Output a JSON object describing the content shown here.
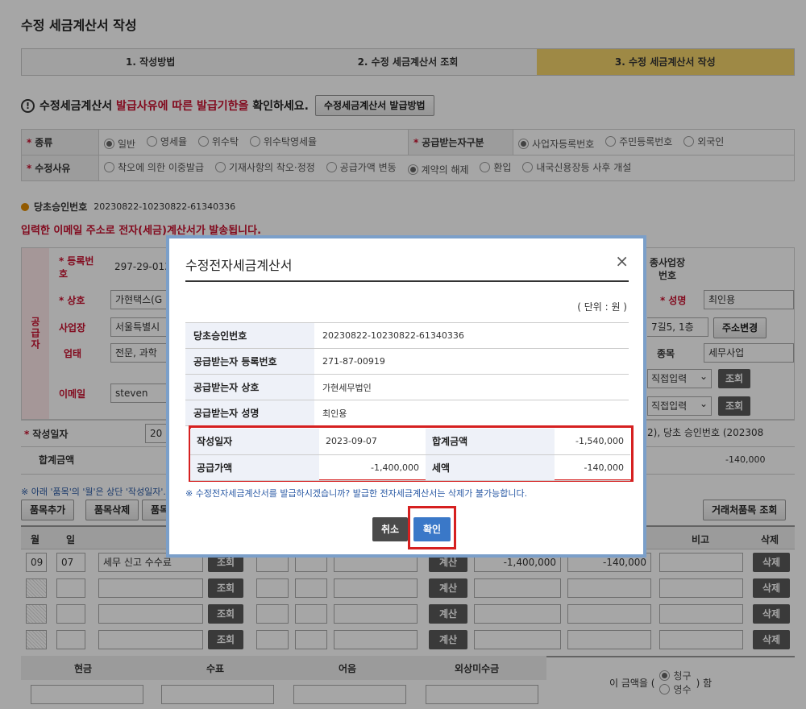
{
  "page": {
    "title": "수정 세금계산서 작성"
  },
  "steps": [
    {
      "label": "1. 작성방법"
    },
    {
      "label": "2. 수정 세금계산서 조회"
    },
    {
      "label": "3. 수정 세금계산서 작성"
    }
  ],
  "notice": {
    "prefix": "수정세금계산서",
    "emphasis": "발급사유에 따른 발급기한을",
    "suffix": "확인하세요.",
    "button": "수정세금계산서 발급방법"
  },
  "kind": {
    "label": "종류",
    "options": [
      "일반",
      "영세율",
      "위수탁",
      "위수탁영세율"
    ],
    "receiver_label": "공급받는자구분",
    "receiver_options": [
      "사업자등록번호",
      "주민등록번호",
      "외국인"
    ]
  },
  "reason": {
    "label": "수정사유",
    "options": [
      "착오에 의한 이중발급",
      "기재사항의 착오·정정",
      "공급가액 변동",
      "계약의 해제",
      "환입",
      "내국신용장등 사후 개설"
    ]
  },
  "original": {
    "label": "당초승인번호",
    "value": "20230822-10230822-61340336"
  },
  "email_notice": "입력한 이메일 주소로 전자(세금)계산서가 발송됩니다.",
  "supplier": {
    "side": "공급자",
    "reg_label": "등록번호",
    "reg_value": "297-29-01318",
    "name_label": "상호",
    "name_value": "가현택스(G",
    "addr_label": "사업장",
    "addr_value": "서울특별시",
    "type_label": "업태",
    "type_value": "전문, 과학",
    "email_label": "이메일",
    "email_value": "steven",
    "sub_branch": "종사업장 번호",
    "rep_label": "성명",
    "rep_value": "최인용",
    "addr_tail": "7길5, 1층",
    "addr_btn": "주소변경",
    "item_label": "종목",
    "item_value": "세무사업",
    "direct": "직접입력",
    "lookup": "조회"
  },
  "date_row": {
    "label": "작성일자",
    "value_prefix": "20",
    "tail": "2), 당초 승인번호 (202308"
  },
  "total_row": {
    "label": "합계금액",
    "value": "-140,000"
  },
  "items": {
    "note": "※ 아래 '품목'의 '월'은 상단 '작성일자'...",
    "add": "품목추가",
    "del": "품목삭제",
    "more": "품목",
    "partner": "거래처품목 조회",
    "headers": {
      "month": "월",
      "day": "일",
      "remark": "비고",
      "delete": "삭제"
    },
    "rows": [
      {
        "month": "09",
        "day": "07",
        "name": "세무 신고 수수료",
        "supply": "-1,400,000",
        "tax": "-140,000"
      },
      {
        "month": "",
        "day": "",
        "name": "",
        "supply": "",
        "tax": ""
      },
      {
        "month": "",
        "day": "",
        "name": "",
        "supply": "",
        "tax": ""
      },
      {
        "month": "",
        "day": "",
        "name": "",
        "supply": "",
        "tax": ""
      }
    ],
    "lookup": "조회",
    "calc": "계산",
    "delete": "삭제"
  },
  "payment": {
    "cols": [
      "현금",
      "수표",
      "어음",
      "외상미수금"
    ],
    "phrase_prefix": "이 금액을 (",
    "opt1": "청구",
    "opt2": "영수",
    "phrase_suffix": ") 함"
  },
  "modal": {
    "title": "수정전자세금계산서",
    "close": "×",
    "unit": "( 단위 : 원 )",
    "rows": [
      {
        "key": "당초승인번호",
        "value": "20230822-10230822-61340336"
      },
      {
        "key": "공급받는자 등록번호",
        "value": "271-87-00919"
      },
      {
        "key": "공급받는자 상호",
        "value": "가현세무법인"
      },
      {
        "key": "공급받는자 성명",
        "value": "최인용"
      }
    ],
    "date_label": "작성일자",
    "date_value": "2023-09-07",
    "total_label": "합계금액",
    "total_value": "-1,540,000",
    "supply_label": "공급가액",
    "supply_value": "-1,400,000",
    "tax_label": "세액",
    "tax_value": "-140,000",
    "warning": "※ 수정전자세금계산서를 발급하시겠습니까? 발급한 전자세금계산서는 삭제가 불가능합니다.",
    "cancel": "취소",
    "confirm": "확인"
  }
}
